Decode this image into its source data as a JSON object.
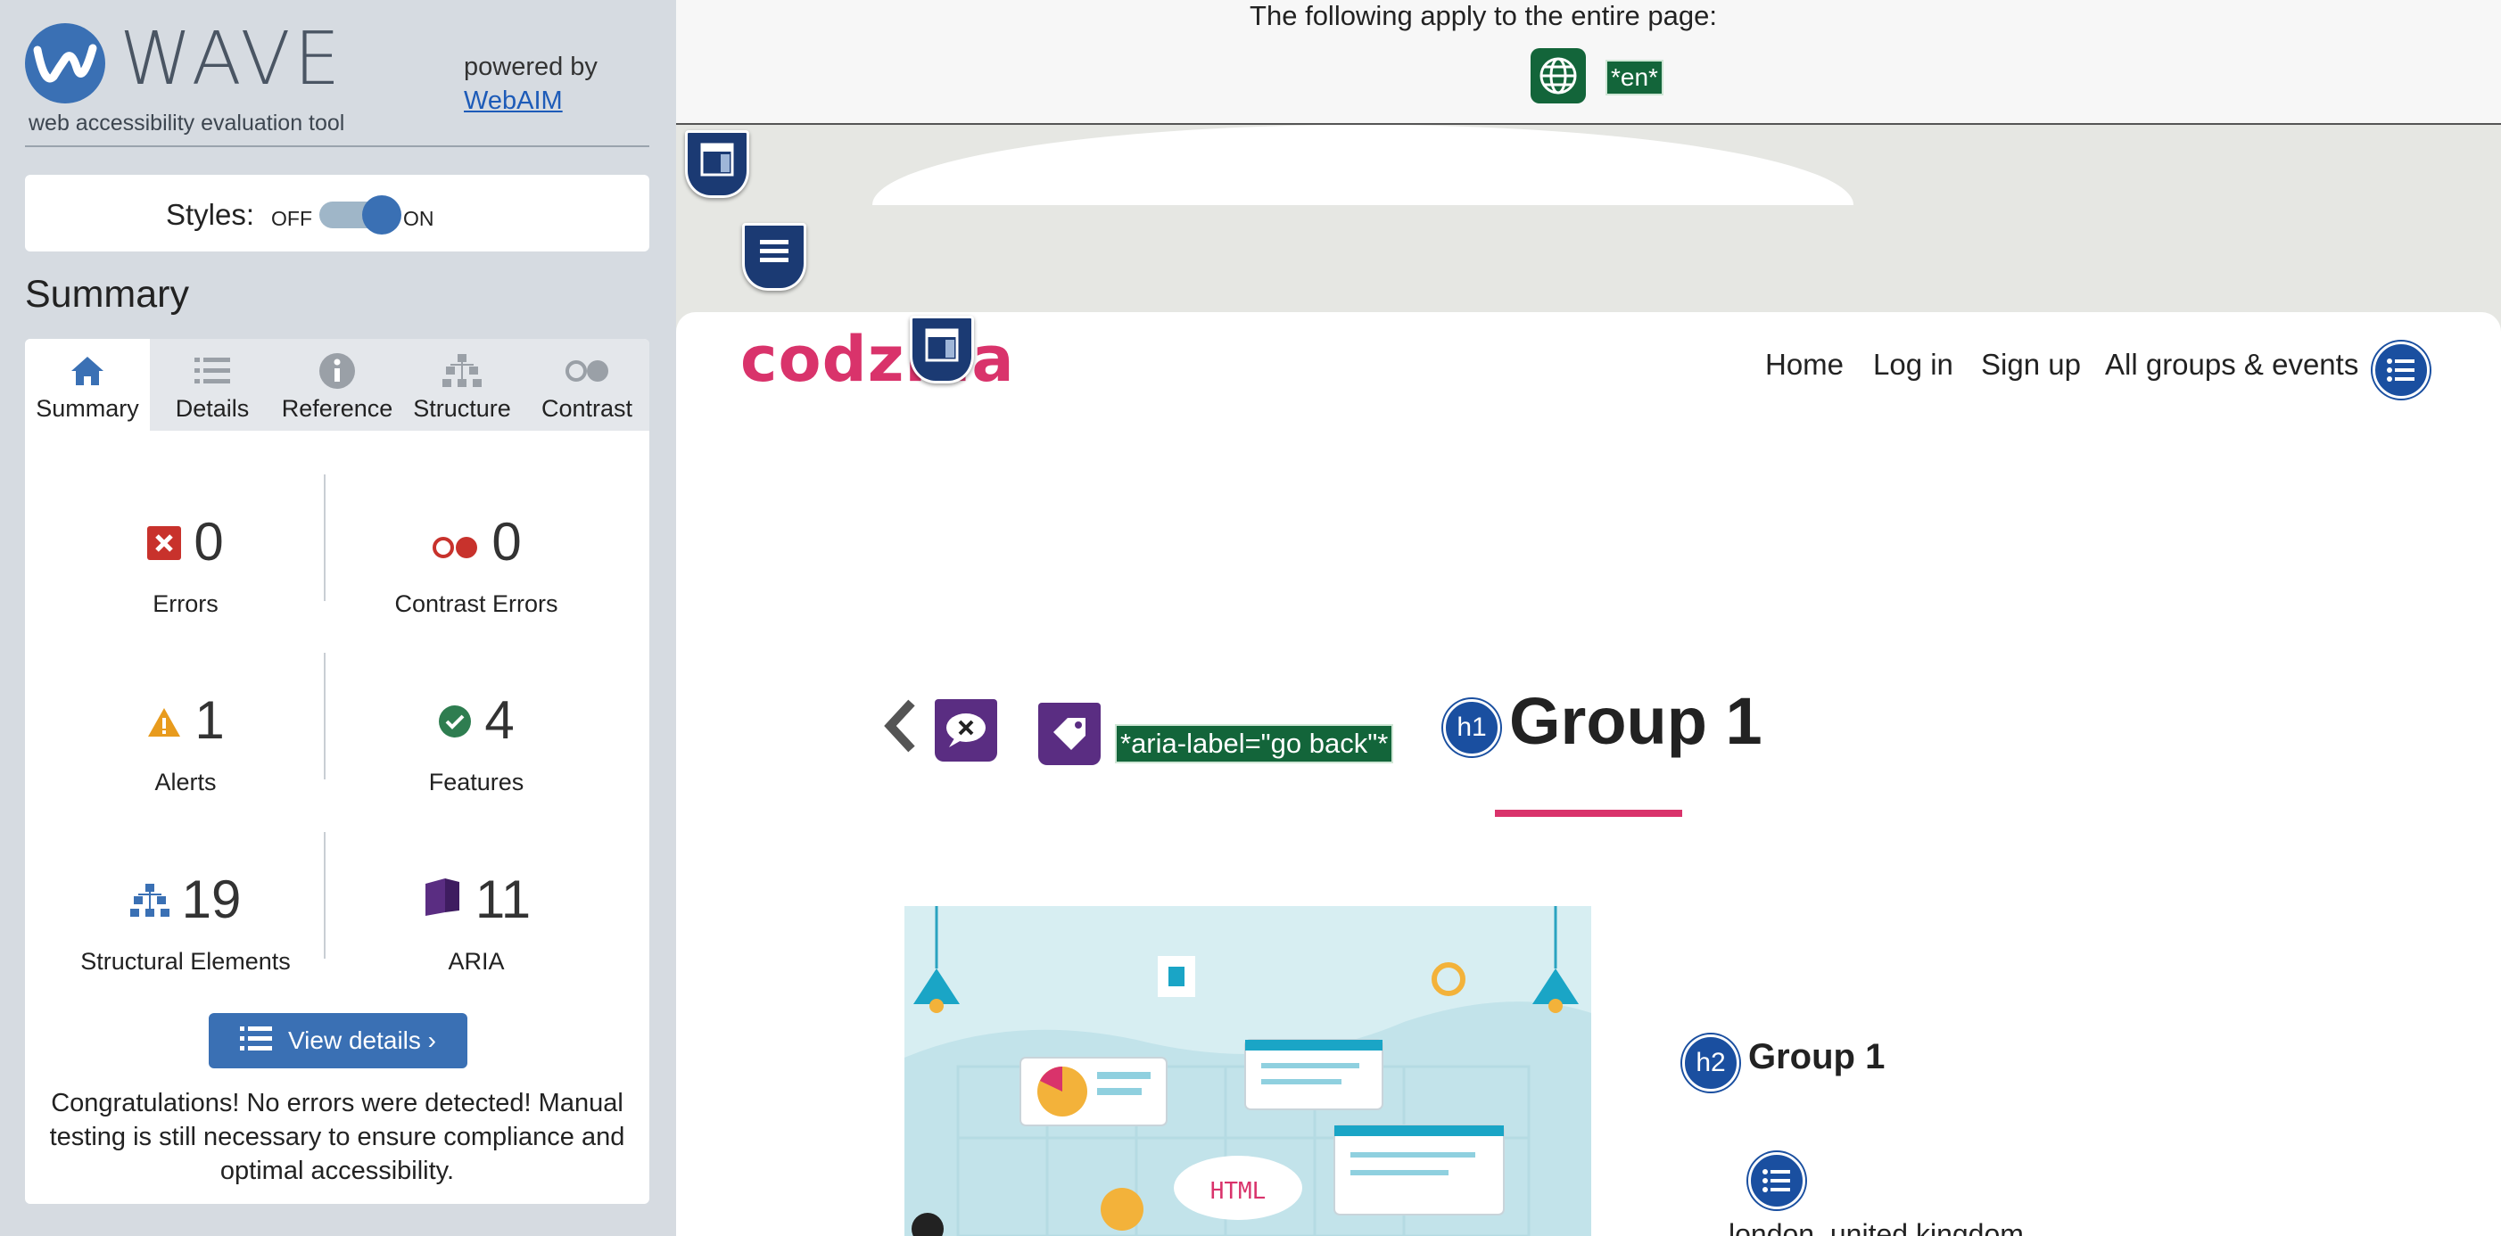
{
  "sidebar": {
    "logo_word": "WAVE",
    "logo_tagline": "web accessibility evaluation tool",
    "powered_by": "powered by",
    "webaim_link": "WebAIM",
    "styles_label": "Styles:",
    "styles_off": "OFF",
    "styles_on": "ON",
    "styles_enabled": true,
    "summary_heading": "Summary",
    "tabs": [
      {
        "label": "Summary",
        "icon": "home-icon",
        "active": true
      },
      {
        "label": "Details",
        "icon": "list-icon",
        "active": false
      },
      {
        "label": "Reference",
        "icon": "info-icon",
        "active": false
      },
      {
        "label": "Structure",
        "icon": "hierarchy-icon",
        "active": false
      },
      {
        "label": "Contrast",
        "icon": "contrast-icon",
        "active": false
      }
    ],
    "stats": {
      "errors": {
        "count": "0",
        "label": "Errors",
        "icon": "error-icon",
        "color": "#c8322c"
      },
      "contrast_errors": {
        "count": "0",
        "label": "Contrast Errors",
        "icon": "contrast-error-icon",
        "color": "#c8322c"
      },
      "alerts": {
        "count": "1",
        "label": "Alerts",
        "icon": "alert-icon",
        "color": "#e89b1d"
      },
      "features": {
        "count": "4",
        "label": "Features",
        "icon": "feature-check-icon",
        "color": "#2e7d50"
      },
      "structural": {
        "count": "19",
        "label": "Structural Elements",
        "icon": "structure-icon",
        "color": "#3a70b4"
      },
      "aria": {
        "count": "11",
        "label": "ARIA",
        "icon": "aria-icon",
        "color": "#5a2d82"
      }
    },
    "view_details_label": "View details ›",
    "congrats_text": "Congratulations! No errors were detected! Manual testing is still necessary to ensure compliance and optimal accessibility."
  },
  "page": {
    "top_notice": "The following apply to the entire page:",
    "lang_tag": "*en*",
    "brand": "codzilla",
    "nav": [
      "Home",
      "Log in",
      "Sign up",
      "All groups & events"
    ],
    "aria_label_tag": "*aria-label=\"go back\"*",
    "h1_badge": "h1",
    "h1_text": "Group 1",
    "h2_badge": "h2",
    "h2_text": "Group 1",
    "illustration_text": "HTML",
    "location_text": "london, united kingdom"
  },
  "colors": {
    "wave_blue": "#3a70b4",
    "sidebar_bg": "#d6dbe1",
    "brand_pink": "#d9336b",
    "wave_green": "#13653a",
    "aria_purple": "#5a2d82",
    "structure_blue": "#1a4fa0"
  }
}
